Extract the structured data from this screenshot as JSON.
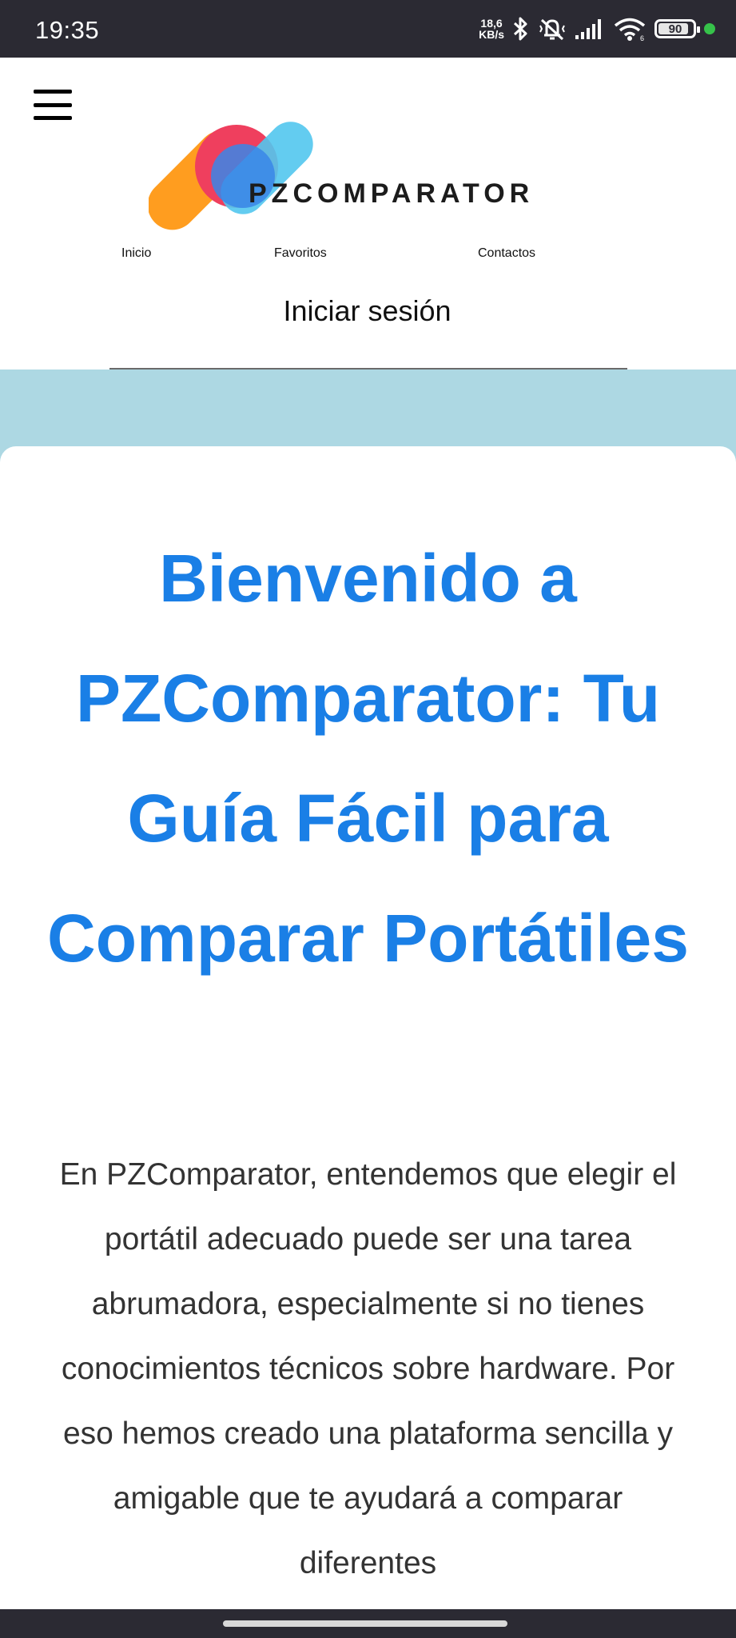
{
  "status_bar": {
    "time": "19:35",
    "net_speed_value": "18,6",
    "net_speed_unit": "KB/s",
    "battery_level": "90",
    "battery_fraction": 0.9,
    "icons": [
      "bluetooth-icon",
      "silent-icon",
      "signal-icon",
      "wifi-icon",
      "battery-icon",
      "privacy-dot-icon"
    ]
  },
  "header": {
    "menu_icon": "hamburger-menu-icon",
    "logo_text": "PZCOMPARATOR",
    "nav": {
      "home": "Inicio",
      "favorites": "Favoritos",
      "contacts": "Contactos",
      "login": "Iniciar sesión"
    }
  },
  "main": {
    "title": "Bienvenido a PZComparator: Tu Guía Fácil para Comparar Portátiles",
    "intro": "En PZComparator, entendemos que elegir el portátil adecuado puede ser una tarea abrumadora, especialmente si no tienes conocimientos técnicos sobre hardware. Por eso hemos creado una plataforma sencilla y amigable que te ayudará a comparar diferentes"
  },
  "colors": {
    "status_bar": "#2b2a33",
    "band": "#add8e3",
    "title": "#1a7fe6",
    "text": "#333333",
    "logo_orange": "#ff9d1f",
    "logo_red": "#ef3f5e",
    "logo_cyan": "#52c7ee",
    "logo_blue": "#3a86e8"
  }
}
